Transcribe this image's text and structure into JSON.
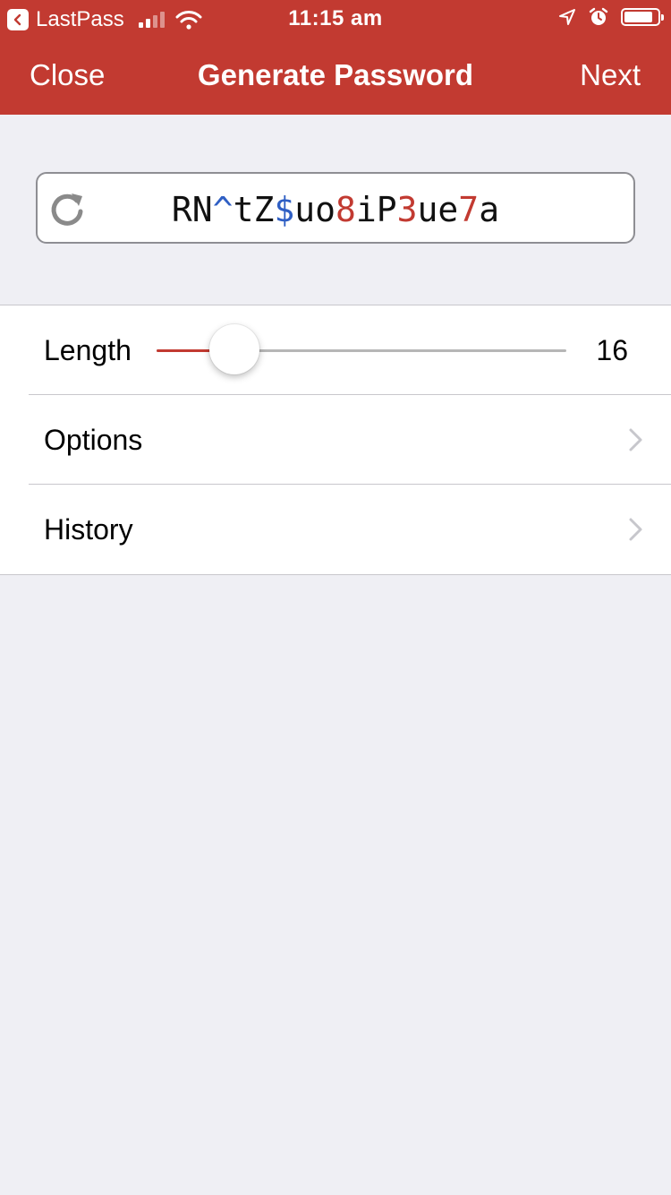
{
  "status_bar": {
    "back_app": "LastPass",
    "time": "11:15 am",
    "signal_bars_filled": 2,
    "signal_bars_total": 4,
    "battery_level": 0.85
  },
  "navbar": {
    "left": "Close",
    "title": "Generate Password",
    "right": "Next"
  },
  "password": {
    "segments": [
      {
        "text": "RN",
        "type": "letter"
      },
      {
        "text": "^",
        "type": "symbol"
      },
      {
        "text": "tZ",
        "type": "letter"
      },
      {
        "text": "$",
        "type": "symbol"
      },
      {
        "text": "uo",
        "type": "letter"
      },
      {
        "text": "8",
        "type": "number"
      },
      {
        "text": "iP",
        "type": "letter"
      },
      {
        "text": "3",
        "type": "number"
      },
      {
        "text": "ue",
        "type": "letter"
      },
      {
        "text": "7",
        "type": "number"
      },
      {
        "text": "a",
        "type": "letter"
      }
    ]
  },
  "settings": {
    "length_label": "Length",
    "length_value": "16",
    "length_slider_fraction": 0.19,
    "options_label": "Options",
    "history_label": "History"
  },
  "colors": {
    "accent": "#c23a31",
    "symbol": "#2f5fc4",
    "number": "#c23a31",
    "background": "#efeff4"
  },
  "icons": {
    "back": "chevron-left-icon",
    "refresh": "refresh-icon",
    "chevron": "chevron-right-icon",
    "location": "location-arrow-icon",
    "alarm": "alarm-icon"
  }
}
